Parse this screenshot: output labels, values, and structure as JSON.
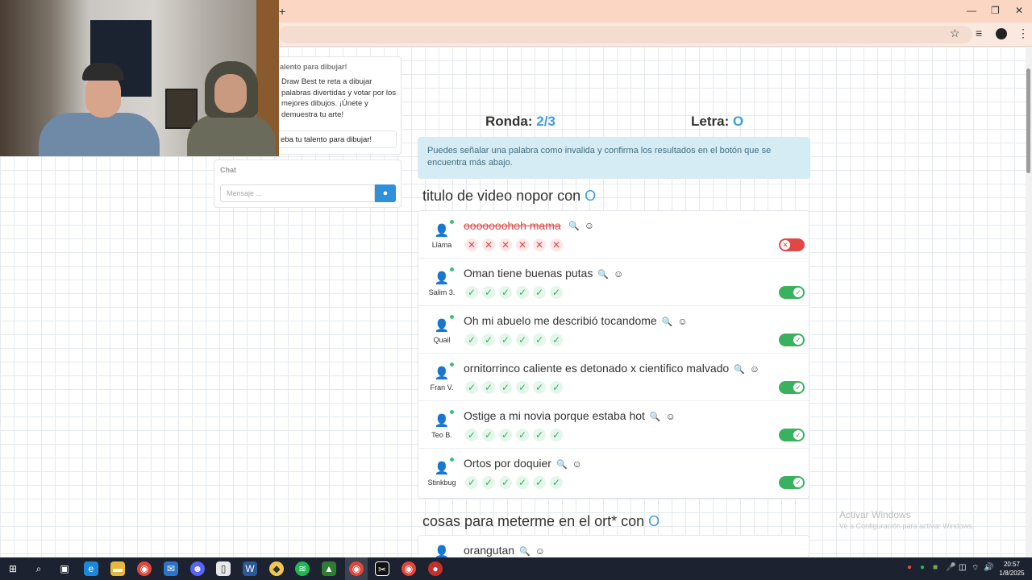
{
  "browser": {
    "new_tab_symbol": "+",
    "minimize": "—",
    "restore": "❐",
    "close": "✕"
  },
  "promo": {
    "title": "alento para dibujar!",
    "text": "Draw Best te reta a dibujar palabras divertidas y votar por los mejores dibujos. ¡Únete y demuestra tu arte!",
    "button": "eba tu talento para dibujar!"
  },
  "chat": {
    "title": "Chat",
    "placeholder": "Mensaje ..."
  },
  "round": {
    "label": "Ronda:",
    "value": "2/3"
  },
  "letter": {
    "label": "Letra:",
    "value": "O"
  },
  "info": "Puedes señalar una palabra como invalida y confirma los resultados en el botón que se encuentra más abajo.",
  "categories": [
    {
      "title": "titulo de video nopor con",
      "letter": "O",
      "answers": [
        {
          "player": "Llama",
          "text": "ooooooohoh mama",
          "valid": false,
          "votes": [
            "✕",
            "✕",
            "✕",
            "✕",
            "✕",
            "✕"
          ]
        },
        {
          "player": "Salim 3.",
          "text": "Oman tiene buenas putas",
          "valid": true,
          "votes": [
            "✓",
            "✓",
            "✓",
            "✓",
            "✓",
            "✓"
          ]
        },
        {
          "player": "Quail",
          "text": "Oh mi abuelo me describió tocandome",
          "valid": true,
          "votes": [
            "✓",
            "✓",
            "✓",
            "✓",
            "✓",
            "✓"
          ]
        },
        {
          "player": "Fran V.",
          "text": "ornitorrinco caliente es detonado x cientifico malvado",
          "valid": true,
          "votes": [
            "✓",
            "✓",
            "✓",
            "✓",
            "✓",
            "✓"
          ]
        },
        {
          "player": "Teo B.",
          "text": "Ostige a mi novia porque estaba hot",
          "valid": true,
          "votes": [
            "✓",
            "✓",
            "✓",
            "✓",
            "✓",
            "✓"
          ]
        },
        {
          "player": "Stinkbug",
          "text": "Ortos por doquier",
          "valid": true,
          "votes": [
            "✓",
            "✓",
            "✓",
            "✓",
            "✓",
            "✓"
          ]
        }
      ]
    },
    {
      "title": "cosas para meterme en el ort* con",
      "letter": "O",
      "answers": [
        {
          "player": "",
          "text": "orangutan"
        }
      ]
    }
  ],
  "watermark": {
    "line1": "Activar Windows",
    "line2": "Ve a Configuración para activar Windows."
  },
  "taskbar": {
    "time": "20:57",
    "date": "1/8/2025"
  },
  "colors": {
    "accent": "#3a9fe0",
    "valid": "#3ab15f",
    "invalid": "#e04848",
    "tab_bg": "#fbd6c3"
  }
}
